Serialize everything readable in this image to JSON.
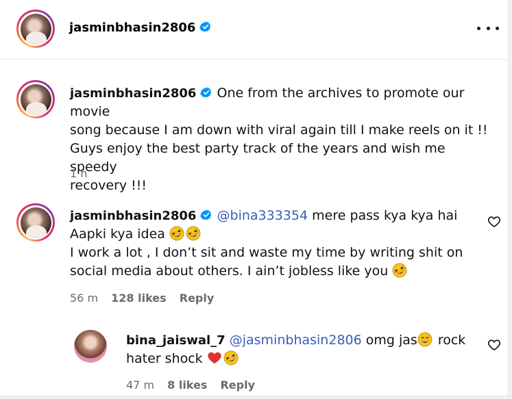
{
  "header": {
    "username": "jasminbhasin2806"
  },
  "caption": {
    "username": "jasminbhasin2806",
    "text_line1": "One from the archives to promote our movie",
    "text_line2": "song because I am down with viral again till I make reels on it !!",
    "text_line3": "Guys enjoy the best party track of the years and wish me speedy",
    "text_line4": "recovery !!!",
    "time": "1 h"
  },
  "comments": [
    {
      "username": "jasminbhasin2806",
      "mention": "@bina333354",
      "text_line1": " mere pass kya kya hai",
      "text_line2": "Aapki kya idea",
      "text_line3": "I work a lot , I don’t sit and waste my time by writing shit on",
      "text_line4": "social media about others. I ain’t jobless like you",
      "time": "56 m",
      "likes": "128 likes",
      "reply": "Reply"
    }
  ],
  "reply": {
    "username": "bina_jaiswal_7",
    "mention": "@jasminbhasin2806",
    "text_line1a": " omg jas",
    "text_line1b": " rock",
    "text_line2": "hater shock",
    "time": "47 m",
    "likes": "8 likes",
    "reply": "Reply"
  },
  "icons": {
    "verified": "verified-badge-icon",
    "more": "more-options-icon",
    "like": "heart-outline-icon",
    "laugh": "rolling-laughing-emoji",
    "grin": "grinning-sweat-emoji",
    "heart_red": "red-heart-emoji"
  },
  "colors": {
    "verified_blue": "#0095f6",
    "mention": "#3b5bb5",
    "meta_gray": "#6b6b6b",
    "heart_red": "#e0312f"
  }
}
